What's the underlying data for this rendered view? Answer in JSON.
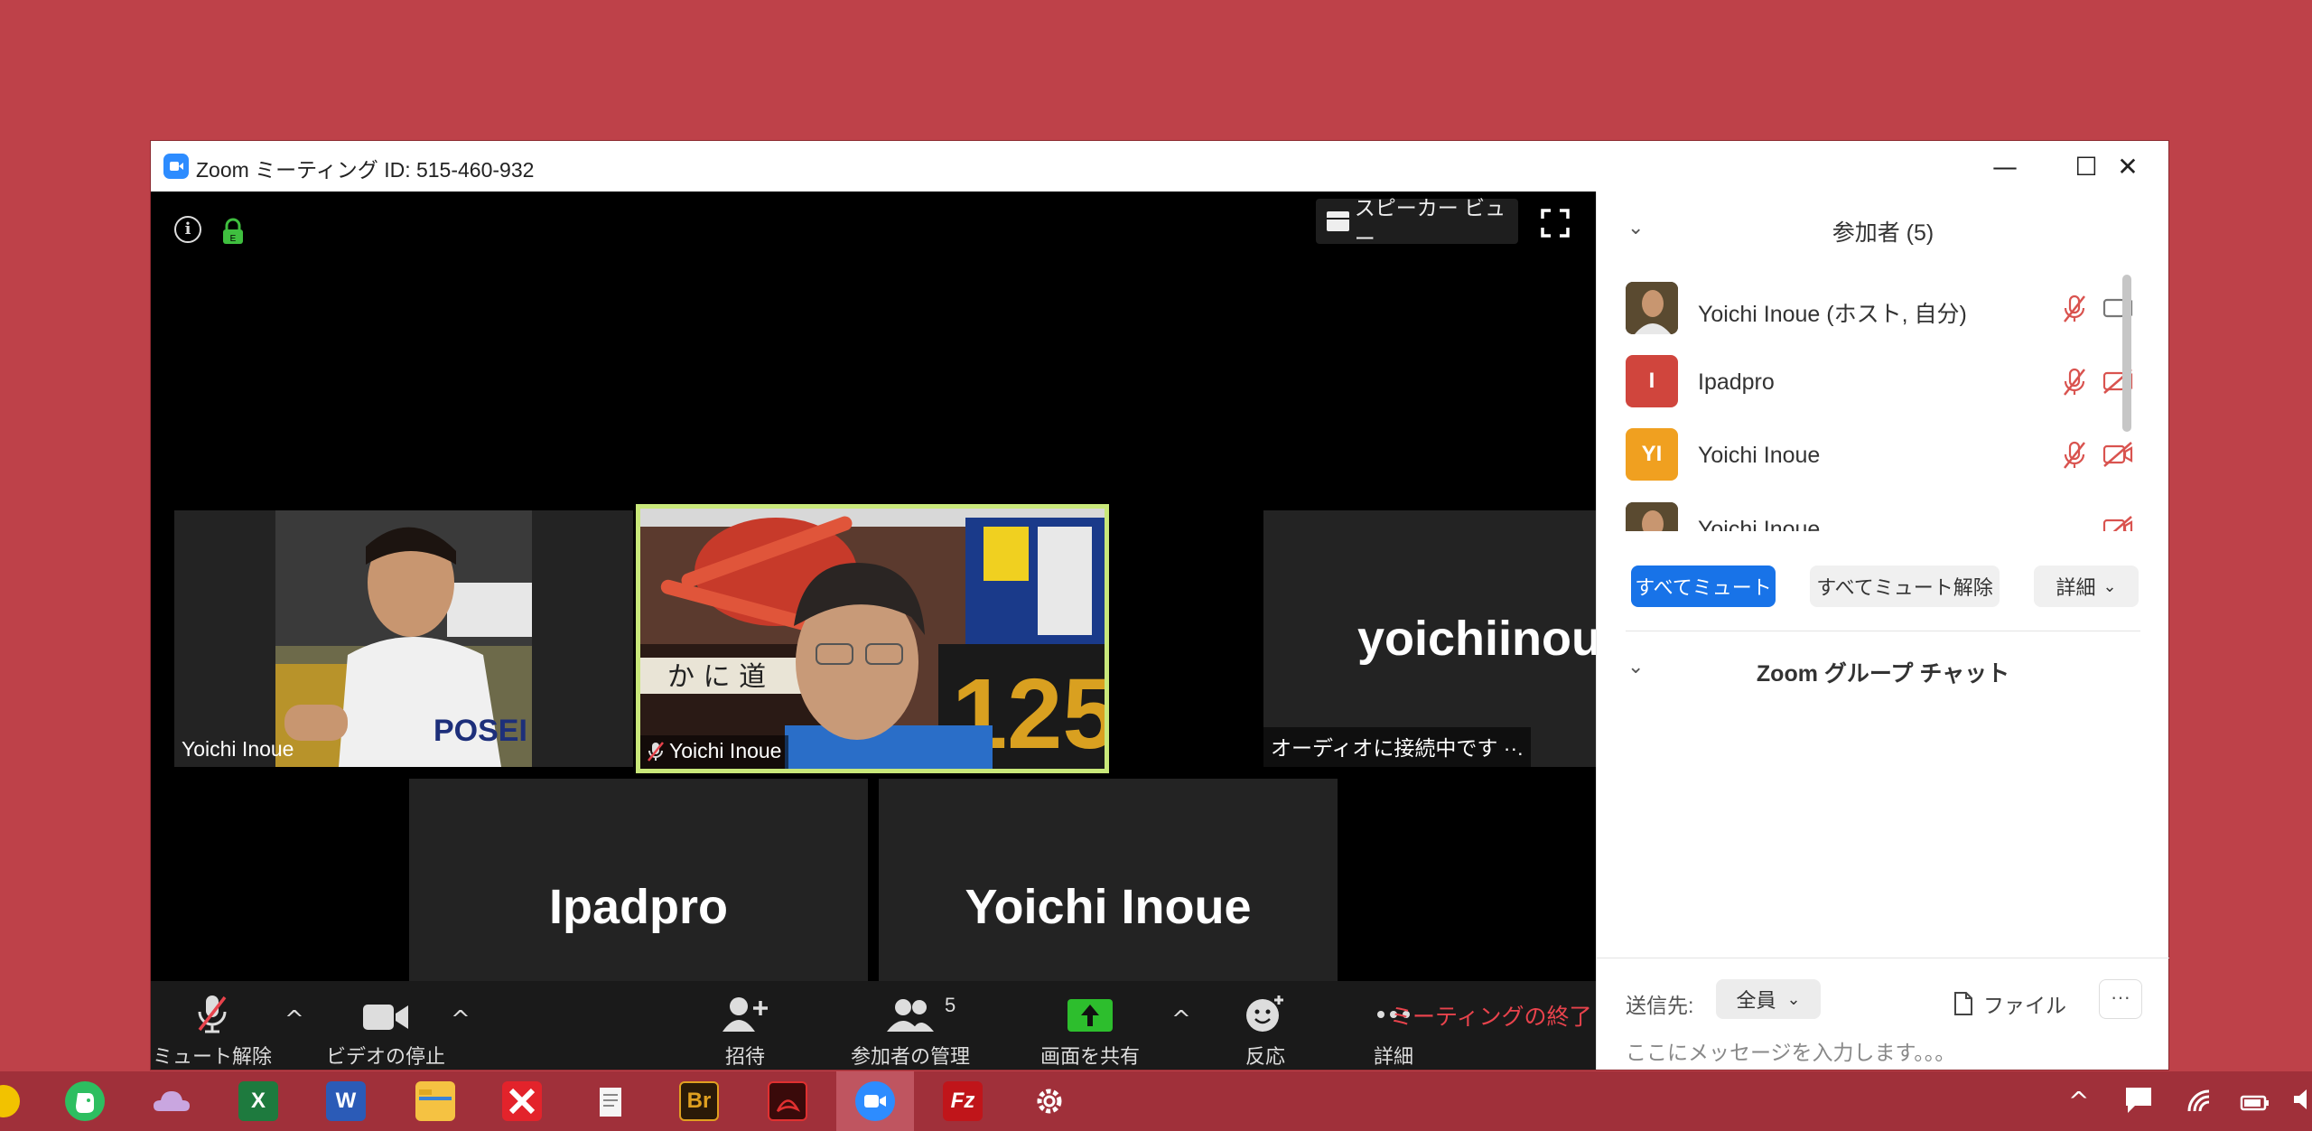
{
  "window": {
    "title": "Zoom ミーティング ID: 515-460-932",
    "minimize": "—",
    "maximize": "☐",
    "close": "✕"
  },
  "video": {
    "speaker_view_label": "スピーカー ビュー",
    "tiles": [
      {
        "name": "Yoichi Inoue",
        "type": "video-photo"
      },
      {
        "name": "Yoichi Inoue",
        "type": "video-live",
        "active": true
      },
      {
        "big_name": "yoichiinoue",
        "status": "オーディオに接続中です ··."
      },
      {
        "big_name": "Ipadpro"
      },
      {
        "big_name": "Yoichi Inoue"
      }
    ]
  },
  "toolbar": {
    "unmute": "ミュート解除",
    "stop_video": "ビデオの停止",
    "invite": "招待",
    "participants": "参加者の管理",
    "participants_count": "5",
    "share": "画面を共有",
    "reactions": "反応",
    "more": "詳細",
    "end": "ミーティングの終了"
  },
  "panel": {
    "participants_title": "参加者 (5)",
    "participants": [
      {
        "name": "Yoichi Inoue (ホスト, 自分)",
        "avatar": "photo",
        "mic": "muted",
        "cam": "on"
      },
      {
        "name": "Ipadpro",
        "avatar_text": "I",
        "avatar_color": "#d0453d",
        "mic": "muted",
        "cam": "off"
      },
      {
        "name": "Yoichi Inoue",
        "avatar_text": "YI",
        "avatar_color": "#f0a020",
        "mic": "muted",
        "cam": "off"
      },
      {
        "name": "Yoichi Inoue",
        "avatar": "photo",
        "mic": "none",
        "cam": "off"
      }
    ],
    "mute_all": "すべてミュート",
    "unmute_all": "すべてミュート解除",
    "details": "詳細",
    "chat_title": "Zoom グループ チャット",
    "send_to_label": "送信先:",
    "send_to_value": "全員",
    "file_label": "ファイル",
    "more_label": "···",
    "chat_placeholder": "ここにメッセージを入力します。。。"
  },
  "colors": {
    "desktop": "#be4149",
    "accent_blue": "#1873e8",
    "end_red": "#e8434c",
    "share_green": "#2dbe2d",
    "active_border": "#c9e87a"
  }
}
